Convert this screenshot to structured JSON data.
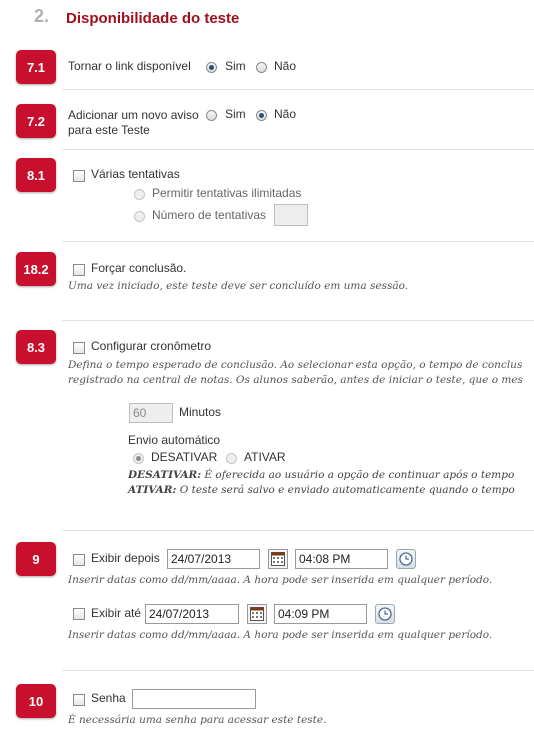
{
  "section": {
    "number": "2.",
    "title": "Disponibilidade do teste"
  },
  "badges": {
    "b71": "7.1",
    "b72": "7.2",
    "b81": "8.1",
    "b182": "18.2",
    "b83": "8.3",
    "b9": "9",
    "b10": "10"
  },
  "link_available": {
    "label": "Tornar o link disponível",
    "yes": "Sim",
    "no": "Não",
    "selected": "Sim"
  },
  "announcement": {
    "label_line1": "Adicionar um novo aviso",
    "label_line2": "para este Teste",
    "yes": "Sim",
    "no": "Não",
    "selected": "Não"
  },
  "attempts": {
    "label": "Várias tentativas",
    "unlimited": "Permitir tentativas ilimitadas",
    "number": "Número de tentativas",
    "number_value": ""
  },
  "force_completion": {
    "label": "Forçar conclusão.",
    "hint": "Uma vez iniciado, este teste deve ser concluído em uma sessão."
  },
  "timer": {
    "label": "Configurar cronômetro",
    "help_line1": "Defina o tempo esperado de conclusão. Ao selecionar esta opção, o tempo de conclus",
    "help_line2": "registrado na central de notas. Os alunos saberão, antes de iniciar o teste, que o mes",
    "minutes_value": "60",
    "minutes_label": "Minutos",
    "auto_submit_label": "Envio automático",
    "off": "DESATIVAR",
    "on": "ATIVAR",
    "selected": "DESATIVAR",
    "off_desc_key": "DESATIVAR:",
    "off_desc": " É oferecida ao usuário a opção de continuar após o tempo",
    "on_desc_key": "ATIVAR:",
    "on_desc": " O teste será salvo e enviado automaticamente quando o tempo"
  },
  "display_after": {
    "label": "Exibir depois",
    "date": "24/07/2013",
    "time": "04:08 PM",
    "hint": "Inserir datas como dd/mm/aaaa. A hora pode ser inserida em qualquer período."
  },
  "display_until": {
    "label": "Exibir até",
    "date": "24/07/2013",
    "time": "04:09 PM",
    "hint": "Inserir datas como dd/mm/aaaa. A hora pode ser inserida em qualquer período."
  },
  "password": {
    "label": "Senha",
    "value": "",
    "hint": "É necessária uma senha para acessar este teste."
  },
  "icons": {
    "calendar": "calendar-icon",
    "clock": "clock-icon"
  },
  "colors": {
    "accent": "#a0101c",
    "badge": "#c8102e"
  }
}
